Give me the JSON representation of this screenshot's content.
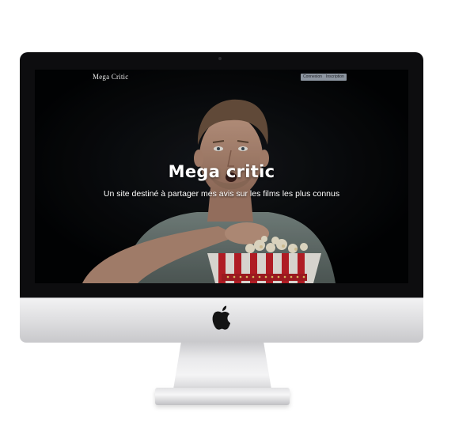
{
  "site": {
    "brand": "Mega Critic",
    "nav": {
      "login_label": "Connexion",
      "signup_label": "Inscription"
    },
    "hero": {
      "title": "Mega critic",
      "subtitle": "Un site destiné à partager mes avis sur les films les plus connus"
    }
  },
  "device": {
    "type": "iMac",
    "logo_icon": "apple-logo-icon"
  },
  "colors": {
    "screen_background": "#020304",
    "nav_button": "#8c95a0",
    "hero_text": "#ffffff",
    "popcorn_stripe_red": "#c8202a"
  }
}
